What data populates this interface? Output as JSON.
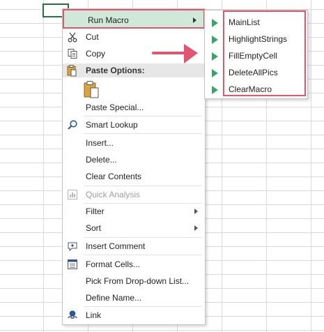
{
  "context_menu": {
    "run_macro": "Run Macro",
    "cut": "Cut",
    "copy": "Copy",
    "paste_options": "Paste Options:",
    "paste_special": "Paste Special...",
    "smart_lookup": "Smart Lookup",
    "insert": "Insert...",
    "delete": "Delete...",
    "clear_contents": "Clear Contents",
    "quick_analysis": "Quick Analysis",
    "filter": "Filter",
    "sort": "Sort",
    "insert_comment": "Insert Comment",
    "format_cells": "Format Cells...",
    "pick_from_list": "Pick From Drop-down List...",
    "define_name": "Define Name...",
    "link": "Link"
  },
  "macros": [
    "MainList",
    "HighlightStrings",
    "FillEmptyCell",
    "DeleteAllPics",
    "ClearMacro"
  ],
  "colors": {
    "highlight_border": "#e0566e",
    "run_macro_bg": "#cfe8d8",
    "play_icon": "#3ca36b",
    "active_cell": "#217346"
  }
}
